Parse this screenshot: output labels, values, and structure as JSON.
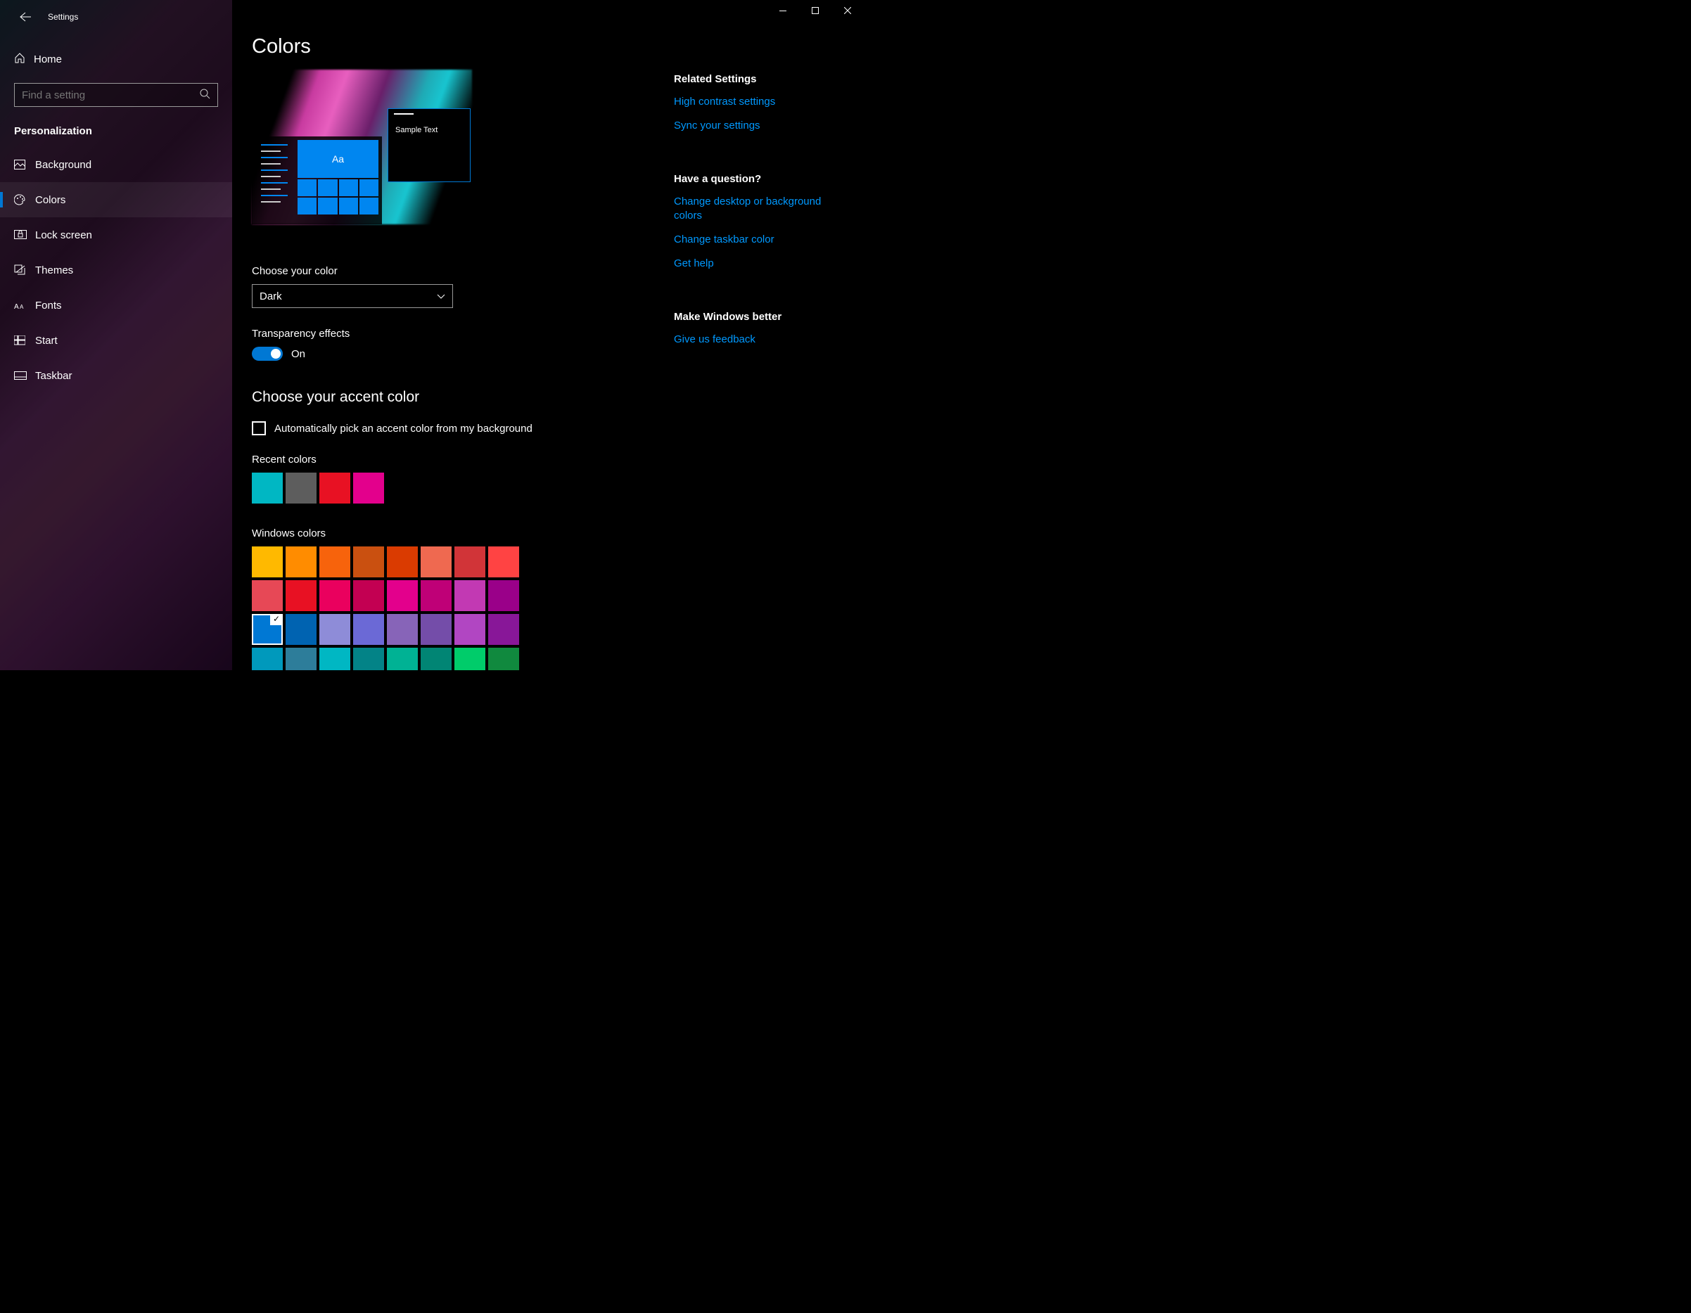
{
  "titlebar": {
    "app_name": "Settings"
  },
  "sidebar": {
    "home": "Home",
    "search_placeholder": "Find a setting",
    "section": "Personalization",
    "items": [
      {
        "label": "Background"
      },
      {
        "label": "Colors"
      },
      {
        "label": "Lock screen"
      },
      {
        "label": "Themes"
      },
      {
        "label": "Fonts"
      },
      {
        "label": "Start"
      },
      {
        "label": "Taskbar"
      }
    ]
  },
  "page": {
    "title": "Colors",
    "preview_sample": "Sample Text",
    "preview_tile": "Aa",
    "choose_color_label": "Choose your color",
    "choose_color_value": "Dark",
    "transparency_label": "Transparency effects",
    "transparency_value": "On",
    "accent_heading": "Choose your accent color",
    "auto_pick_label": "Automatically pick an accent color from my background",
    "recent_label": "Recent colors",
    "recent_colors": [
      "#00b7c3",
      "#5d5d5d",
      "#e81123",
      "#e3008c"
    ],
    "windows_label": "Windows colors",
    "windows_colors": [
      "#ffb900",
      "#ff8c00",
      "#f7630c",
      "#ca5010",
      "#da3b01",
      "#ef6950",
      "#d13438",
      "#ff4343",
      "#e74856",
      "#e81123",
      "#ea005e",
      "#c30052",
      "#e3008c",
      "#bf0077",
      "#c239b3",
      "#9a0089",
      "#0078d4",
      "#0063b1",
      "#8e8cd8",
      "#6b69d6",
      "#8764b8",
      "#744da9",
      "#b146c2",
      "#881798",
      "#0099bc",
      "#2d7d9a",
      "#00b7c3",
      "#038387",
      "#00b294",
      "#018574",
      "#00cc6a",
      "#10893e"
    ],
    "selected_index": 16
  },
  "right": {
    "related_h": "Related Settings",
    "related": [
      "High contrast settings",
      "Sync your settings"
    ],
    "question_h": "Have a question?",
    "question": [
      "Change desktop or background colors",
      "Change taskbar color",
      "Get help"
    ],
    "better_h": "Make Windows better",
    "better": [
      "Give us feedback"
    ]
  }
}
